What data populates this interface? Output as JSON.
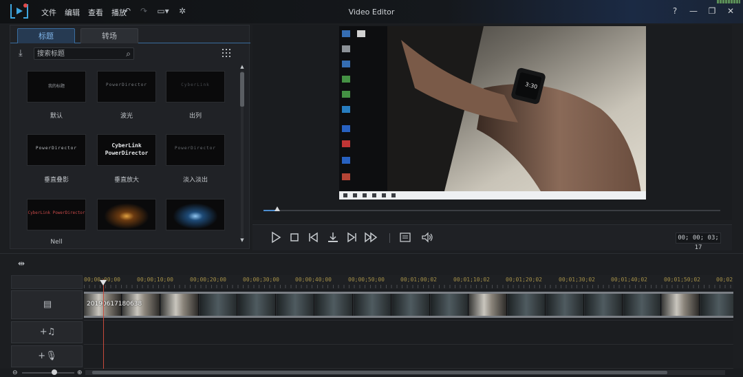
{
  "app": {
    "title": "Video Editor",
    "menu": [
      "文件",
      "编辑",
      "查看",
      "播放"
    ],
    "window_controls": {
      "help": "?",
      "minimize": "—",
      "restore": "❐",
      "close": "✕"
    }
  },
  "library": {
    "tabs": [
      {
        "label": "标题",
        "active": true
      },
      {
        "label": "转场",
        "active": false
      }
    ],
    "search_placeholder": "搜索标题",
    "templates": [
      {
        "label": "默认",
        "preview_text": "我的标题"
      },
      {
        "label": "波光",
        "preview_text": "PowerDirector"
      },
      {
        "label": "出列",
        "preview_text": "CyberLink"
      },
      {
        "label": "垂直叠影",
        "preview_text": "PowerDirector"
      },
      {
        "label": "垂直放大",
        "preview_text": "CyberLink PowerDirector"
      },
      {
        "label": "淡入淡出",
        "preview_text": "PowerDirector"
      },
      {
        "label": "Nell",
        "preview_text": "CyberLink PowerDirector"
      },
      {
        "label": "",
        "preview_text": ""
      },
      {
        "label": "",
        "preview_text": ""
      }
    ]
  },
  "preview": {
    "progress_fraction": 0.03,
    "timecode": "00; 00; 03; 17",
    "watch_time": "3:30"
  },
  "timeline": {
    "ruler_labels": [
      "00;00;00;00",
      "00;00;10;00",
      "00;00;20;00",
      "00;00;30;00",
      "00;00;40;00",
      "00;00;50;00",
      "00;01;00;02",
      "00;01;10;02",
      "00;01;20;02",
      "00;01;30;02",
      "00;01;40;02",
      "00;01;50;02",
      "00;02;0"
    ],
    "clip_name": "20190617180638",
    "tracks": [
      "video",
      "music",
      "voice"
    ]
  },
  "colors": {
    "accent": "#4e8ed0",
    "playhead": "#c94a3c",
    "ruler_text": "#a59048"
  }
}
